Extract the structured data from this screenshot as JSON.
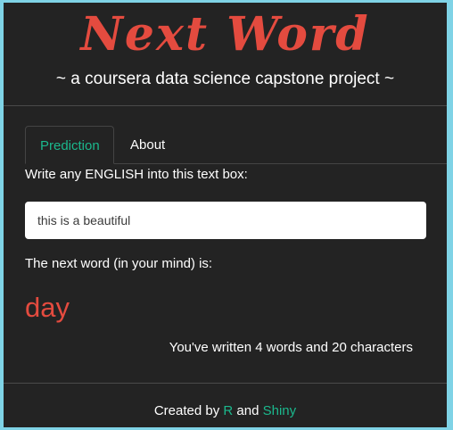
{
  "header": {
    "title": "Next Word",
    "subtitle": "~ a coursera data science capstone project ~"
  },
  "tabs": [
    {
      "label": "Prediction",
      "active": true
    },
    {
      "label": "About",
      "active": false
    }
  ],
  "prediction_tab": {
    "input_label": "Write any ENGLISH into this text box:",
    "input_value": "this is a beautiful",
    "result_label": "The next word (in your mind) is:",
    "predicted_word": "day",
    "count_text": "You've written 4 words and 20 characters"
  },
  "footer": {
    "prefix": "Created by",
    "link_r": "R",
    "middle": "and",
    "link_shiny": "Shiny"
  },
  "colors": {
    "background": "#232323",
    "accent_red": "#e44b3f",
    "accent_green": "#1bb88d"
  }
}
